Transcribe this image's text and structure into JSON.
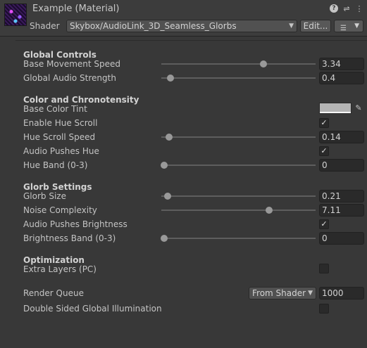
{
  "header": {
    "title": "Example (Material)",
    "shader_label": "Shader",
    "shader_value": "Skybox/AudioLink_3D_Seamless_Glorbs",
    "edit_button": "Edit...",
    "icons": [
      "help-icon",
      "preset-sliders-icon",
      "more-vertical-icon",
      "menu-lines-icon"
    ]
  },
  "sections": {
    "global_controls": {
      "title": "Global Controls",
      "base_movement_speed": {
        "label": "Base Movement Speed",
        "value": "3.34",
        "slider_pct": 66
      },
      "global_audio_strength": {
        "label": "Global Audio Strength",
        "value": "0.4",
        "slider_pct": 6
      }
    },
    "color": {
      "title": "Color and Chronotensity",
      "base_color_tint": {
        "label": "Base Color Tint",
        "color": "#b4b4b4"
      },
      "enable_hue_scroll": {
        "label": "Enable Hue Scroll",
        "checked": "✓"
      },
      "hue_scroll_speed": {
        "label": "Hue Scroll Speed",
        "value": "0.14",
        "slider_pct": 5
      },
      "audio_pushes_hue": {
        "label": "Audio Pushes Hue",
        "checked": "✓"
      },
      "hue_band": {
        "label": "Hue Band (0-3)",
        "value": "0",
        "slider_pct": 2
      }
    },
    "glorb": {
      "title": "Glorb Settings",
      "glorb_size": {
        "label": "Glorb Size",
        "value": "0.21",
        "slider_pct": 4
      },
      "noise_complexity": {
        "label": "Noise Complexity",
        "value": "7.11",
        "slider_pct": 70
      },
      "audio_pushes_brightness": {
        "label": "Audio Pushes Brightness",
        "checked": "✓"
      },
      "brightness_band": {
        "label": "Brightness Band (0-3)",
        "value": "0",
        "slider_pct": 2
      }
    },
    "optimization": {
      "title": "Optimization",
      "extra_layers": {
        "label": "Extra Layers (PC)",
        "checked": ""
      }
    }
  },
  "render_queue": {
    "label": "Render Queue",
    "mode": "From Shader",
    "value": "1000"
  },
  "double_sided_gi": {
    "label": "Double Sided Global Illumination",
    "checked": ""
  }
}
